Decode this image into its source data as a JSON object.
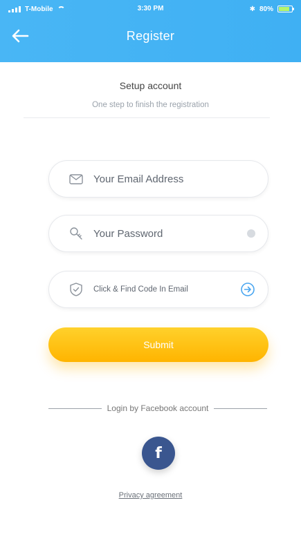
{
  "status_bar": {
    "carrier": "T-Mobile",
    "time": "3:30 PM",
    "battery_text": "80%"
  },
  "nav": {
    "title": "Register",
    "back_icon": "arrow-left-icon"
  },
  "setup": {
    "title": "Setup account",
    "subtitle": "One step to finish the registration"
  },
  "form": {
    "email": {
      "placeholder": "Your Email Address",
      "value": "",
      "icon": "mail-icon"
    },
    "password": {
      "placeholder": "Your Password",
      "value": "",
      "icon": "key-icon",
      "toggle_icon": "eye-icon"
    },
    "code": {
      "placeholder": "Click & Find Code In Email",
      "value": "",
      "icon": "shield-check-icon",
      "action_icon": "arrow-circle-right-icon"
    },
    "submit_label": "Submit"
  },
  "social": {
    "label": "Login by Facebook account",
    "icon": "facebook-icon",
    "glyph": "f"
  },
  "footer": {
    "privacy_label": "Privacy agreement"
  },
  "colors": {
    "header": "#42b2f4",
    "submit": "#ffc107",
    "facebook": "#3a568f"
  }
}
